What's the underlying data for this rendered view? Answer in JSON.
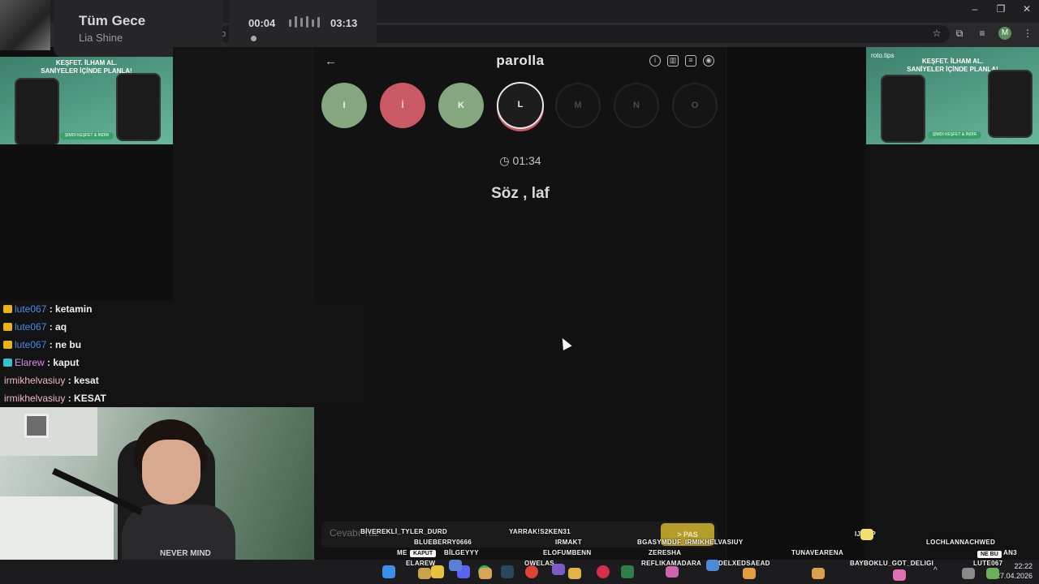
{
  "music": {
    "title": "Tüm Gece",
    "artist": "Lia Shine",
    "time_current": "00:04",
    "time_total": "03:13",
    "progress": 0.02
  },
  "browser": {
    "url_fragment": "b",
    "profile_initial": "M"
  },
  "ads": {
    "left": {
      "headline_1": "KEŞFET. İLHAM AL.",
      "headline_2": "SANİYELER İÇİNDE PLANLA!",
      "button": "ŞİMDİ KEŞFET & İNDİR"
    },
    "right": {
      "brand": "roto.tips",
      "headline_1": "KEŞFET. İLHAM AL.",
      "headline_2": "SANİYELER İÇİNDE PLANLA!",
      "button": "ŞİMDİ KEŞFET & İNDİR"
    }
  },
  "game": {
    "title": "parolla",
    "back_icon": "arrow-left-icon",
    "header_icons": [
      "info-icon",
      "stats-icon",
      "chat-icon",
      "user-icon"
    ],
    "letters": [
      {
        "char": "I",
        "state": "correct",
        "color": "#86a67f"
      },
      {
        "char": "İ",
        "state": "wrong",
        "color": "#c95964"
      },
      {
        "char": "K",
        "state": "correct",
        "color": "#86a67f"
      },
      {
        "char": "L",
        "state": "current"
      },
      {
        "char": "M",
        "state": "pending"
      },
      {
        "char": "N",
        "state": "pending"
      },
      {
        "char": "O",
        "state": "pending"
      }
    ],
    "timer": "01:34",
    "clue": "Söz , laf",
    "answer_placeholder": "Cevabı Yaz",
    "pass_label": "> PAS"
  },
  "chat": [
    {
      "user": "lute067",
      "message": "ketamin",
      "user_color": "#4a8be8",
      "badge_color": "#e8b517"
    },
    {
      "user": "lute067",
      "message": "aq",
      "user_color": "#4a8be8",
      "badge_color": "#e8b517"
    },
    {
      "user": "lute067",
      "message": "ne bu",
      "user_color": "#4a8be8",
      "badge_color": "#e8b517"
    },
    {
      "user": "Elarew",
      "message": "kaput",
      "user_color": "#d38ee8",
      "badge_color": "#35c3c9"
    },
    {
      "user": "irmikhelvasiuy",
      "message": "kesat",
      "user_color": "#f2b8c6"
    },
    {
      "user": "irmikhelvasiuy",
      "message": "KESAT",
      "user_color": "#f2b8c6"
    }
  ],
  "webcam": {
    "shirt_text": "NEVER MIND"
  },
  "overlay_names": [
    "BİVEREKLİ_TYLER_DURD",
    "YARRAK!S2KEN31",
    "BLUEBERRY0666",
    "IRMAKT",
    "BGASYMDUF_IRMIKHELVASIUY",
    "TUNAVEARENA",
    "LOCHLANNACHWED",
    "ME",
    "KAPUT",
    "BİLGEYYY",
    "ELOFUMBENN",
    "ZERESHA",
    "NE BU",
    "AN3",
    "ELAREW",
    "OWELAS",
    "REFLIKAMADARA",
    "DELXEDSAEAD",
    "BAYBOKLU_GOT_DELIGI",
    "LUTE067",
    "IJUMP"
  ],
  "taskbar": {
    "time": "22:22",
    "date": "27.04.2026",
    "apps": [
      "windows-icon",
      "explorer-icon",
      "browser-icon",
      "discord-icon",
      "spotify-icon",
      "steam-icon",
      "chrome-icon",
      "app-icon",
      "app-icon",
      "app-icon",
      "app-icon"
    ]
  }
}
